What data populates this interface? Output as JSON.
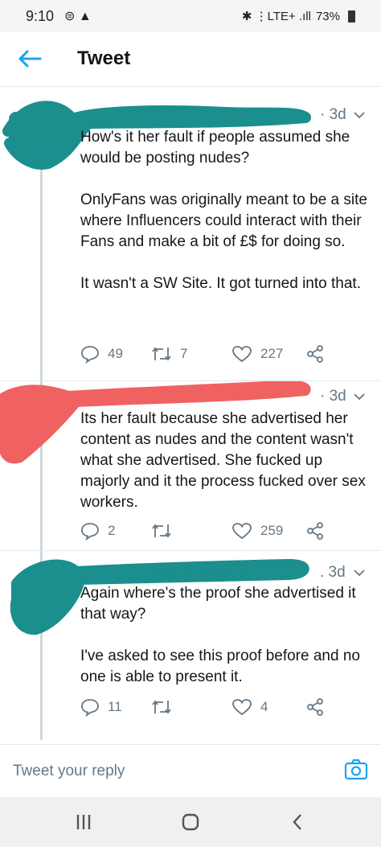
{
  "status_bar": {
    "time": "9:10",
    "left_icons": "⊜ ▲",
    "right_icons": "✱ ⋮LTE+ .ıll",
    "battery": "73%"
  },
  "header": {
    "title": "Tweet"
  },
  "tweets": [
    {
      "time": "· 3d",
      "text": "How's it her fault if people assumed she would be posting nudes?\n\nOnlyFans was originally meant to be a site where Influencers could interact with their Fans and make a bit of £$ for doing so.\n\nIt wasn't a SW Site. It got turned into that.",
      "replies": "49",
      "retweets": "7",
      "likes": "227"
    },
    {
      "time": "· 3d",
      "text": "Its her fault because she advertised her content as nudes and the content wasn't what she advertised. She fucked up majorly and it the process fucked over sex workers.",
      "replies": "2",
      "retweets": "",
      "likes": "259"
    },
    {
      "time": ". 3d",
      "text": "Again where's the proof she advertised it that way?\n\nI've asked to see this proof before and no one is able to present it.",
      "replies": "11",
      "retweets": "",
      "likes": "4"
    }
  ],
  "reply_bar": {
    "placeholder": "Tweet your reply"
  },
  "icons": {
    "reply": "reply-icon",
    "retweet": "retweet-icon",
    "like": "heart-icon",
    "share": "share-icon",
    "camera": "camera-icon",
    "back": "back-arrow-icon"
  },
  "colors": {
    "accent": "#1da1f2",
    "teal_scribble": "#1b8e8e",
    "red_scribble": "#f06262",
    "muted": "#657786"
  }
}
